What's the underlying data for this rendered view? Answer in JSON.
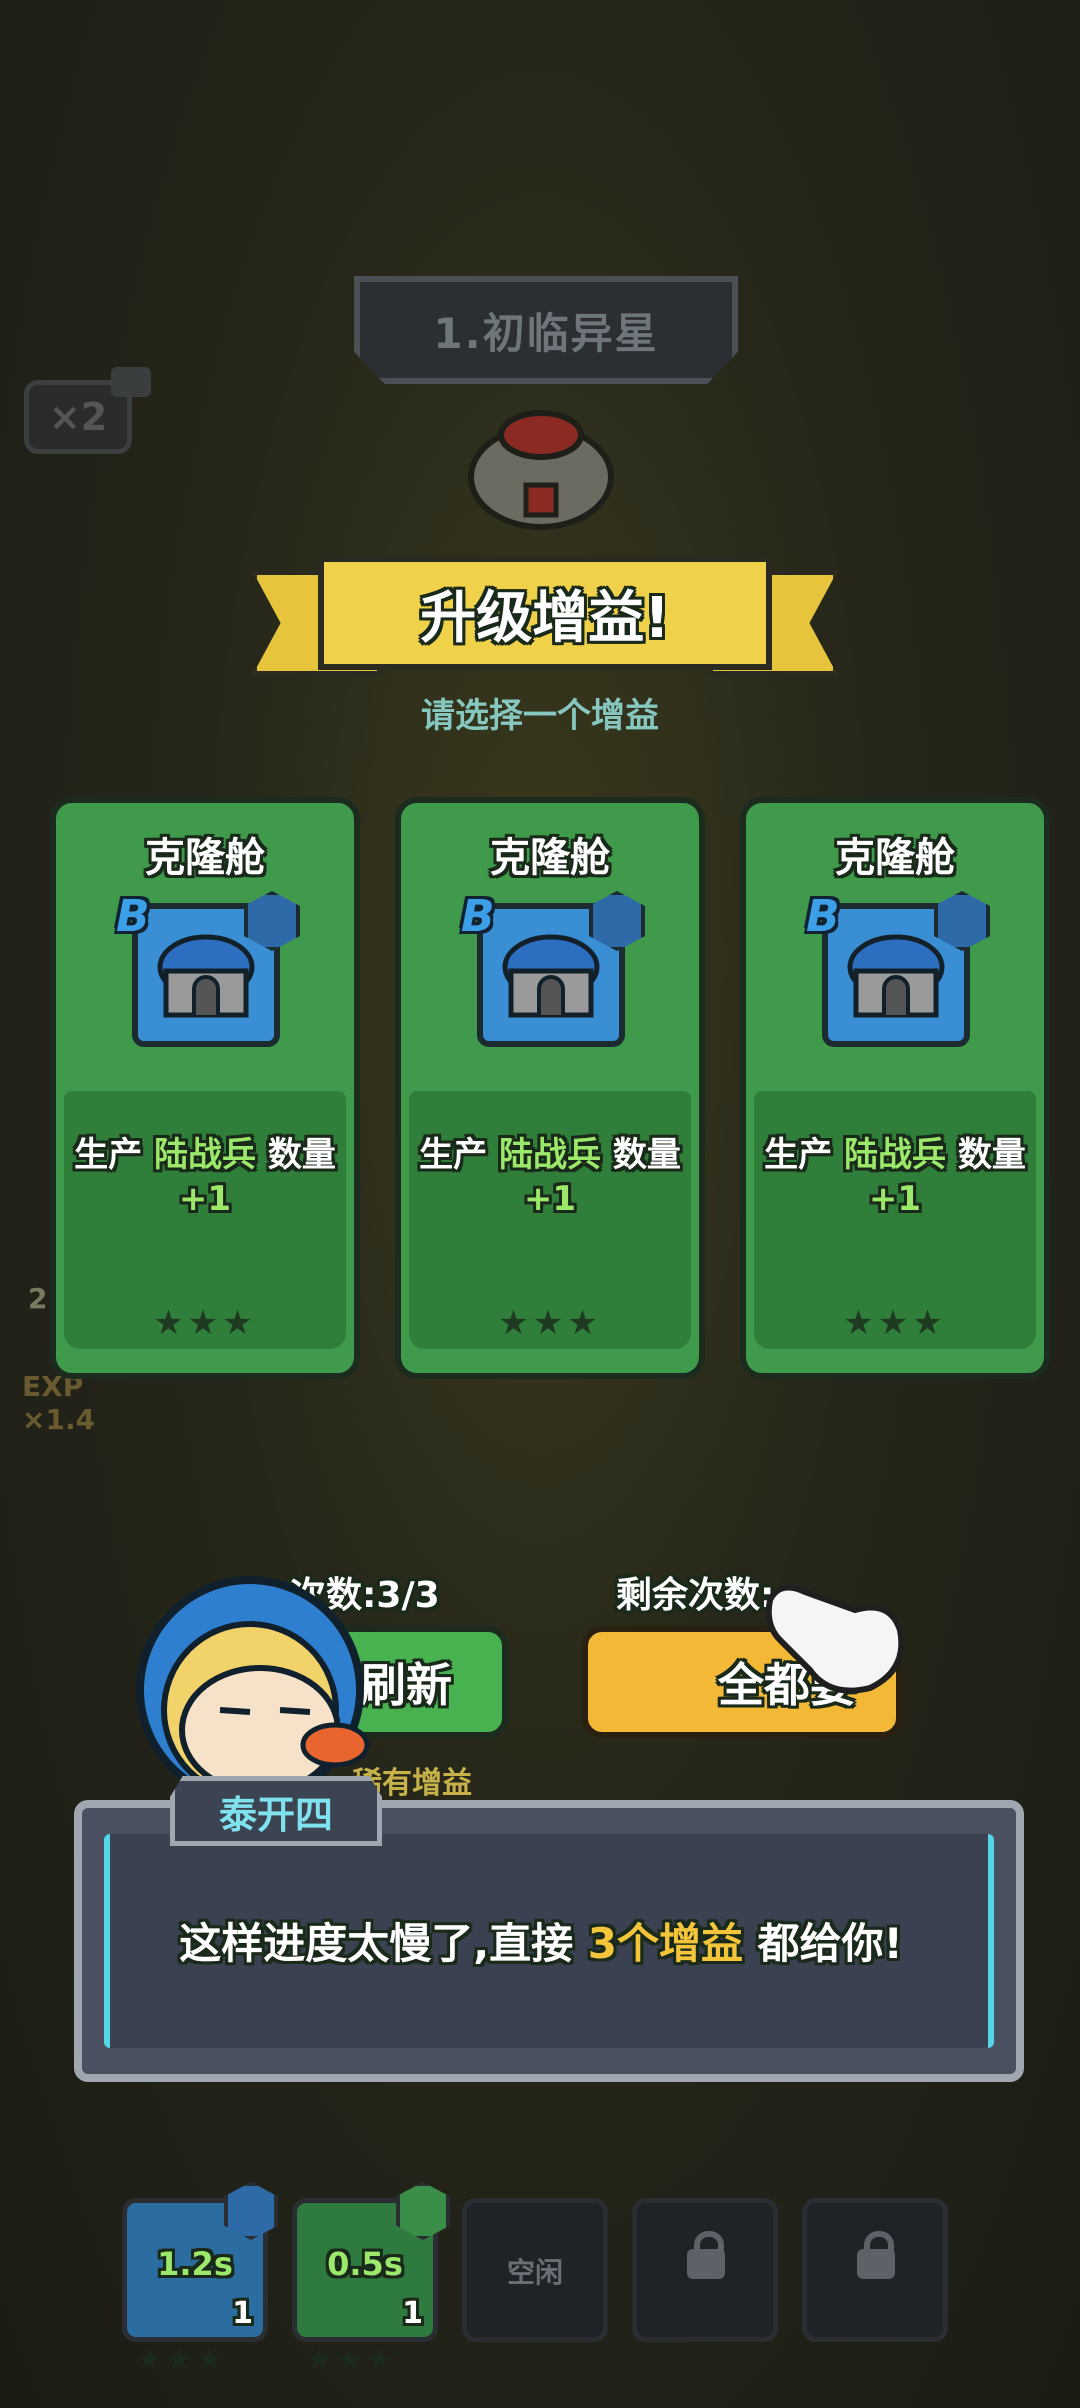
{
  "top": {
    "level_title": "1.初临异星",
    "speed_label": "×2"
  },
  "side": {
    "exp_label": "EXP",
    "exp_multiplier": "×1.4",
    "side_number": "2"
  },
  "banner": {
    "title": "升级增益!",
    "subtitle": "请选择一个增益"
  },
  "cards": [
    {
      "title": "克隆舱",
      "grade": "B",
      "desc_prefix": "生产 ",
      "desc_unit": "陆战兵",
      "desc_mid": " 数量 ",
      "desc_value": "+1",
      "stars": "★★★"
    },
    {
      "title": "克隆舱",
      "grade": "B",
      "desc_prefix": "生产 ",
      "desc_unit": "陆战兵",
      "desc_mid": " 数量 ",
      "desc_value": "+1",
      "stars": "★★★"
    },
    {
      "title": "克隆舱",
      "grade": "B",
      "desc_prefix": "生产 ",
      "desc_unit": "陆战兵",
      "desc_mid": " 数量 ",
      "desc_value": "+1",
      "stars": "★★★"
    }
  ],
  "actions": {
    "refresh_count": "次数:3/3",
    "remaining_count": "剩余次数:",
    "refresh_label": "刷新",
    "all_label": "全都要",
    "rare_label": "稀有增益"
  },
  "dialog": {
    "speaker": "泰开四",
    "text_before": "这样进度太慢了,直接 ",
    "highlight": "3个增益",
    "text_after": " 都给你!"
  },
  "slots": [
    {
      "label": "1.2s",
      "count": "1",
      "stars": "★★★"
    },
    {
      "label": "0.5s",
      "count": "1",
      "stars": "★★★"
    },
    {
      "label": "空闲"
    },
    {
      "label": "locked"
    },
    {
      "label": "locked"
    }
  ],
  "colors": {
    "card_green": "#3f9b4b",
    "highlight_green": "#9be86a",
    "dialog_yellow": "#f4c53b",
    "ribbon_yellow": "#f0d24a"
  }
}
